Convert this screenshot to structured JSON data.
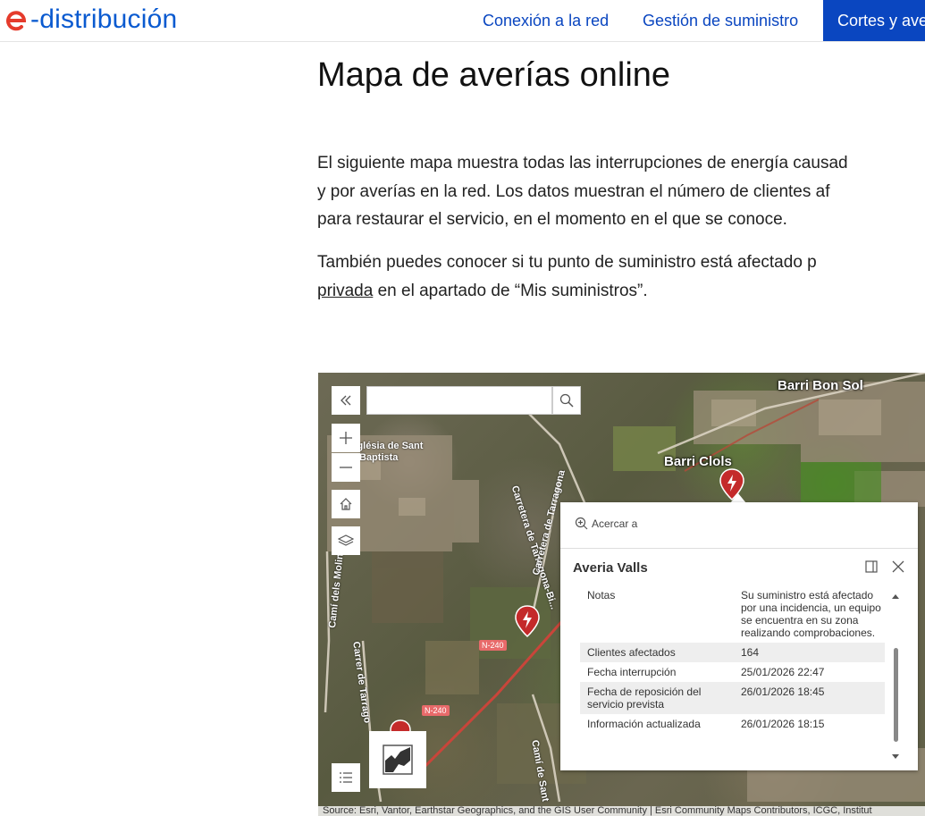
{
  "header": {
    "logo_text": "-distribución",
    "nav": [
      "Conexión a la red",
      "Gestión de suministro",
      "Cortes y ave"
    ]
  },
  "main": {
    "title": "Mapa de averías online",
    "p1_lines": [
      "El siguiente mapa muestra todas las interrupciones de energía causad",
      "y por averías en la red. Los datos muestran el número de clientes af",
      "para restaurar el servicio, en el momento en el que se conoce."
    ],
    "p2_line1": "También puedes conocer si tu punto de suministro está afectado p",
    "p2_link": "privada",
    "p2_rest": " en el apartado de “Mis suministros”."
  },
  "map": {
    "search_placeholder": "",
    "places": {
      "barri_bon_sol": "Barri Bon Sol",
      "barri_clols": "Barri Clols",
      "esglesia": "Església de Sant",
      "baptista": "Baptista"
    },
    "roads": {
      "tarragona_1": "Carretera de Tarragona-Bi...",
      "tarragona_2": "Carretera de Tarragona",
      "tarragona_3": "Carrer de Tarrago",
      "molins": "Camí dels Molins",
      "sant": "Camí de Sant",
      "n240_a": "N-240",
      "n240_b": "N-240"
    },
    "attribution": "Source: Esri, Vantor, Earthstar Geographics, and the GIS User Community | Esri Community Maps Contributors, ICGC, Institut"
  },
  "popup": {
    "zoom_label": "Acercar a",
    "title": "Averia Valls",
    "rows": [
      {
        "k": "Notas",
        "v": "Su suministro está afectado por una incidencia, un equipo se encuentra en su zona realizando comprobaciones."
      },
      {
        "k": "Clientes afectados",
        "v": "164"
      },
      {
        "k": "Fecha interrupción",
        "v": "25/01/2026 22:47"
      },
      {
        "k": "Fecha de reposición del servicio prevista",
        "v": "26/01/2026 18:45"
      },
      {
        "k": "Información actualizada",
        "v": "26/01/2026 18:15"
      }
    ]
  },
  "colors": {
    "brand_blue": "#0a46c0",
    "brand_red": "#e53b2c",
    "marker_red": "#c42a2a"
  }
}
